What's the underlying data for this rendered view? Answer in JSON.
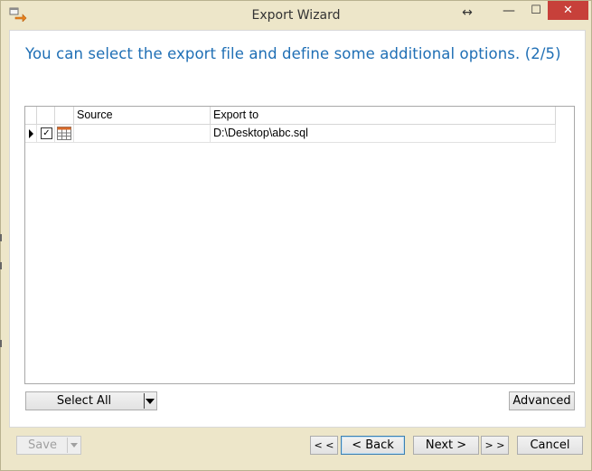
{
  "window": {
    "title": "Export Wizard",
    "controls": {
      "resize": "↔",
      "minimize": "—",
      "maximize": "☐",
      "close": "✕"
    }
  },
  "heading": "You can select the export file and define some additional options. (2/5)",
  "grid": {
    "columns": [
      "Source",
      "Export to"
    ],
    "rows": [
      {
        "checked": true,
        "source": "",
        "export_to": "D:\\Desktop\\abc.sql"
      }
    ]
  },
  "buttons": {
    "select_all": "Select All",
    "advanced": "Advanced",
    "save": "Save",
    "first": "< <",
    "back": "< Back",
    "next": "Next >",
    "last": "> >",
    "cancel": "Cancel"
  },
  "icons": {
    "app": "export-wizard-icon",
    "table": "table-icon"
  },
  "colors": {
    "heading": "#1f6fb5",
    "close": "#c7403a",
    "frame": "#ede6c9"
  }
}
